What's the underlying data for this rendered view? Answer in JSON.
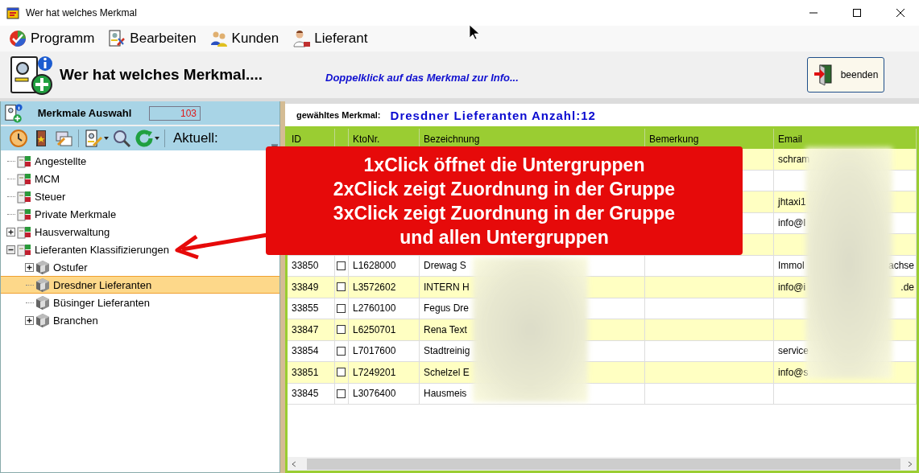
{
  "window": {
    "title": "Wer hat welches Merkmal"
  },
  "menu": [
    {
      "label": "Programm",
      "kind": "program"
    },
    {
      "label": "Bearbeiten",
      "kind": "edit"
    },
    {
      "label": "Kunden",
      "kind": "customers"
    },
    {
      "label": "Lieferant",
      "kind": "supplier"
    }
  ],
  "header": {
    "title": "Wer hat welches Merkmal....",
    "hint": "Doppelklick auf das Merkmal zur Info...",
    "button": "beenden"
  },
  "selection_panel": {
    "title": "Merkmale Auswahl",
    "count": "103",
    "toolbar_label": "Aktuell:"
  },
  "tree": [
    {
      "label": "Angestellte",
      "kind": "group",
      "selected": false
    },
    {
      "label": "MCM",
      "kind": "group",
      "selected": false
    },
    {
      "label": "Steuer",
      "kind": "group",
      "selected": false
    },
    {
      "label": "Private Merkmale",
      "kind": "group",
      "selected": false
    },
    {
      "label": "Hausverwaltung",
      "kind": "group",
      "expanded": false,
      "selected": false
    },
    {
      "label": "Lieferanten Klassifizierungen",
      "kind": "group",
      "expanded": true,
      "selected": false,
      "children": [
        {
          "label": "Ostufer",
          "kind": "box",
          "expanded": false,
          "selected": false
        },
        {
          "label": "Dresdner Lieferanten",
          "kind": "box",
          "selected": true
        },
        {
          "label": "Büsinger Lieferanten",
          "kind": "box",
          "selected": false
        },
        {
          "label": "Branchen",
          "kind": "box",
          "expanded": false,
          "selected": false
        }
      ]
    }
  ],
  "detail": {
    "label": "gewähltes Merkmal:",
    "value": "Dresdner Lieferanten Anzahl:12"
  },
  "table": {
    "columns": [
      {
        "kind": "id",
        "label": "ID"
      },
      {
        "kind": "check"
      },
      {
        "kind": "account",
        "label": "KtoNr."
      },
      {
        "kind": "name",
        "label": "Bezeichnung"
      },
      {
        "kind": "remark",
        "label": "Bemerkung"
      },
      {
        "kind": "email",
        "label": "Email"
      }
    ],
    "rows": [
      {
        "email": "schram"
      },
      {},
      {
        "email": "jhtaxi1"
      },
      {
        "email": "info@l"
      },
      {},
      {
        "id": "33850",
        "checked": false,
        "account": "L1628000",
        "name": "Drewag S",
        "email": "Immol",
        "email_end": "achse"
      },
      {
        "id": "33849",
        "checked": false,
        "account": "L3572602",
        "name": "INTERN H",
        "email": "info@i",
        "email_end": ".de"
      },
      {
        "id": "33855",
        "checked": false,
        "account": "L2760100",
        "name": "Fegus Dre"
      },
      {
        "id": "33847",
        "checked": false,
        "account": "L6250701",
        "name": "Rena Text"
      },
      {
        "id": "33854",
        "checked": false,
        "account": "L7017600",
        "name": "Stadtreinig",
        "email": "service"
      },
      {
        "id": "33851",
        "checked": false,
        "account": "L7249201",
        "name": "Schelzel E",
        "email": "info@s"
      },
      {
        "id": "33845",
        "checked": false,
        "account": "L3076400",
        "name": "Hausmeis"
      }
    ]
  },
  "callout": {
    "lines": [
      "1xClick öffnet die Untergruppen",
      "2xClick zeigt Zuordnung in der Gruppe",
      "3xClick zeigt Zuordnung in der Gruppe",
      "und allen Untergruppen"
    ]
  }
}
